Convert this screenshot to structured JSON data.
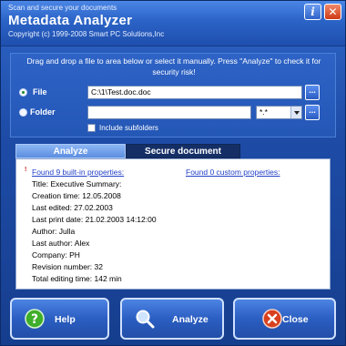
{
  "window": {
    "subtitle": "Scan and secure your documents",
    "title": "Metadata Analyzer",
    "copyright": "Copyright (c) 1999-2008 Smart PC Solutions,Inc",
    "info_button": "i",
    "close_button": "✕"
  },
  "input_panel": {
    "instructions": "Drag and drop a file to area below or select it manually. Press \"Analyze\" to check it for security risk!",
    "file_label": "File",
    "file_value": "C:\\1\\Test.doc.doc",
    "folder_label": "Folder",
    "folder_value": "",
    "filter_value": "*.*",
    "browse_label": "...",
    "include_subfolders_label": "Include subfolders"
  },
  "tabs": {
    "analyze": "Analyze",
    "secure": "Secure document"
  },
  "results": {
    "warn_marker": "!",
    "builtin_link": "Found 9 built-in properties:",
    "custom_link": "Found 0 custom properties:",
    "properties": [
      "Title: Executive Summary:",
      "Creation time: 12.05.2008",
      "Last edited: 27.02.2003",
      "Last print date: 21.02.2003 14:12:00",
      "Author: Julla",
      "Last author: Alex",
      "Company: PH",
      "Revision number: 32",
      "Total editing time: 142 min"
    ]
  },
  "buttons": {
    "help": "Help",
    "analyze": "Analyze",
    "close": "Close"
  },
  "colors": {
    "accent": "#2457b6",
    "link": "#2340c8",
    "help_icon": "#3fae2a",
    "close_icon": "#d8401e"
  }
}
